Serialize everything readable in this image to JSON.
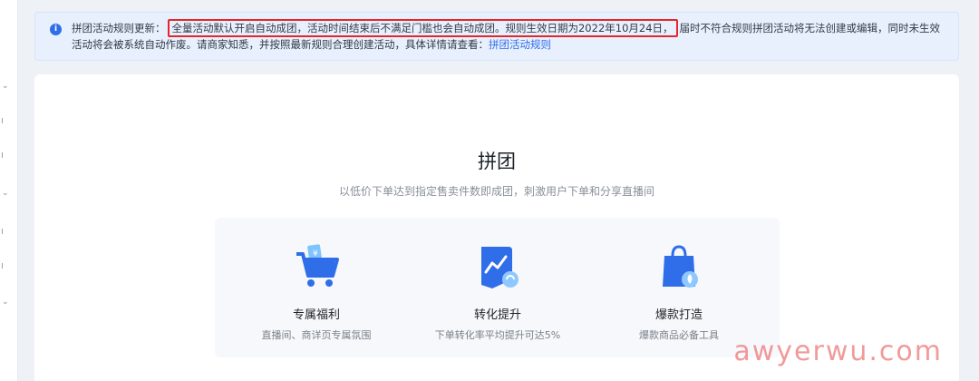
{
  "notice": {
    "prefix": "拼团活动规则更新：",
    "highlight": "全量活动默认开启自动成团，活动时间结束后不满足门槛也会自动成团。规则生效日期为2022年10月24日，",
    "suffix": "届时不符合规则拼团活动将无法创建或编辑，同时未生效活动将会被系统自动作废。请商家知悉，并按照最新规则合理创建活动，具体详情请查看：",
    "link": "拼团活动规则"
  },
  "main": {
    "title": "拼团",
    "subtitle": "以低价下单达到指定售卖件数即成团，刺激用户下单和分享直播间"
  },
  "features": [
    {
      "icon": "shopping-cart-icon",
      "title": "专属福利",
      "desc": "直播间、商详页专属氛围"
    },
    {
      "icon": "conversion-chart-icon",
      "title": "转化提升",
      "desc": "下单转化率平均提升可达5%"
    },
    {
      "icon": "shopping-bag-icon",
      "title": "爆款打造",
      "desc": "爆款商品必备工具"
    }
  ],
  "watermark": "awyerwu.com",
  "colors": {
    "accent": "#2f6ee8",
    "highlight_border": "#e4272a",
    "notice_bg": "#e8f0fe"
  }
}
